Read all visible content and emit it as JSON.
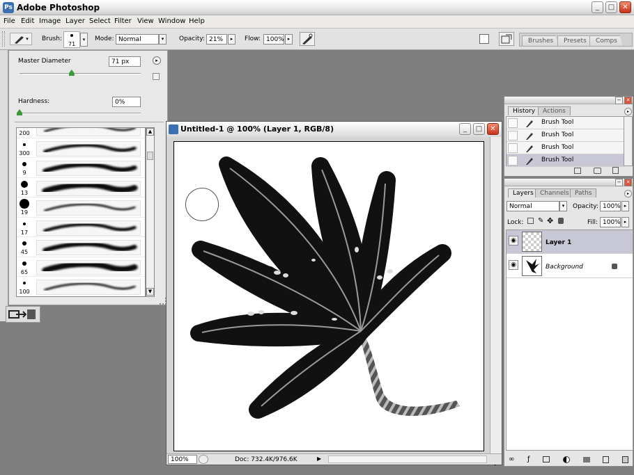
{
  "app": {
    "title": "Adobe Photoshop",
    "icon": "photoshop-app-icon"
  },
  "window_controls": {
    "minimize": "_",
    "maximize": "□",
    "close": "✕"
  },
  "menu": [
    "File",
    "Edit",
    "Image",
    "Layer",
    "Select",
    "Filter",
    "View",
    "Window",
    "Help"
  ],
  "options_bar": {
    "brush_label": "Brush:",
    "brush_size": "71",
    "mode_label": "Mode:",
    "mode_value": "Normal",
    "opacity_label": "Opacity:",
    "opacity_value": "21%",
    "flow_label": "Flow:",
    "flow_value": "100%",
    "palette_tabs": [
      "Brushes",
      "Presets",
      "Comps"
    ]
  },
  "brush_picker": {
    "master_diameter_label": "Master Diameter",
    "master_diameter_value": "71 px",
    "master_diameter_level": 0.43,
    "hardness_label": "Hardness:",
    "hardness_value": "0%",
    "hardness_level": 0,
    "presets": [
      {
        "size": "200",
        "dot": 0
      },
      {
        "size": "300",
        "dot": 2
      },
      {
        "size": "9",
        "dot": 3
      },
      {
        "size": "13",
        "dot": 5
      },
      {
        "size": "19",
        "dot": 7
      },
      {
        "size": "17",
        "dot": 2
      },
      {
        "size": "45",
        "dot": 3
      },
      {
        "size": "65",
        "dot": 3
      },
      {
        "size": "100",
        "dot": 2
      }
    ]
  },
  "document": {
    "title": "Untitled-1 @ 100% (Layer 1, RGB/8)",
    "zoom": "100%",
    "doc_info": "Doc: 732.4K/976.6K"
  },
  "history": {
    "tabs": [
      "History",
      "Actions"
    ],
    "items": [
      "Brush Tool",
      "Brush Tool",
      "Brush Tool",
      "Brush Tool"
    ],
    "selected_index": 3
  },
  "layers": {
    "tabs": [
      "Layers",
      "Channels",
      "Paths"
    ],
    "blend_mode": "Normal",
    "opacity_label": "Opacity:",
    "opacity_value": "100%",
    "lock_label": "Lock:",
    "fill_label": "Fill:",
    "fill_value": "100%",
    "items": [
      {
        "name": "Layer 1",
        "selected": true
      },
      {
        "name": "Background",
        "selected": false
      }
    ]
  }
}
